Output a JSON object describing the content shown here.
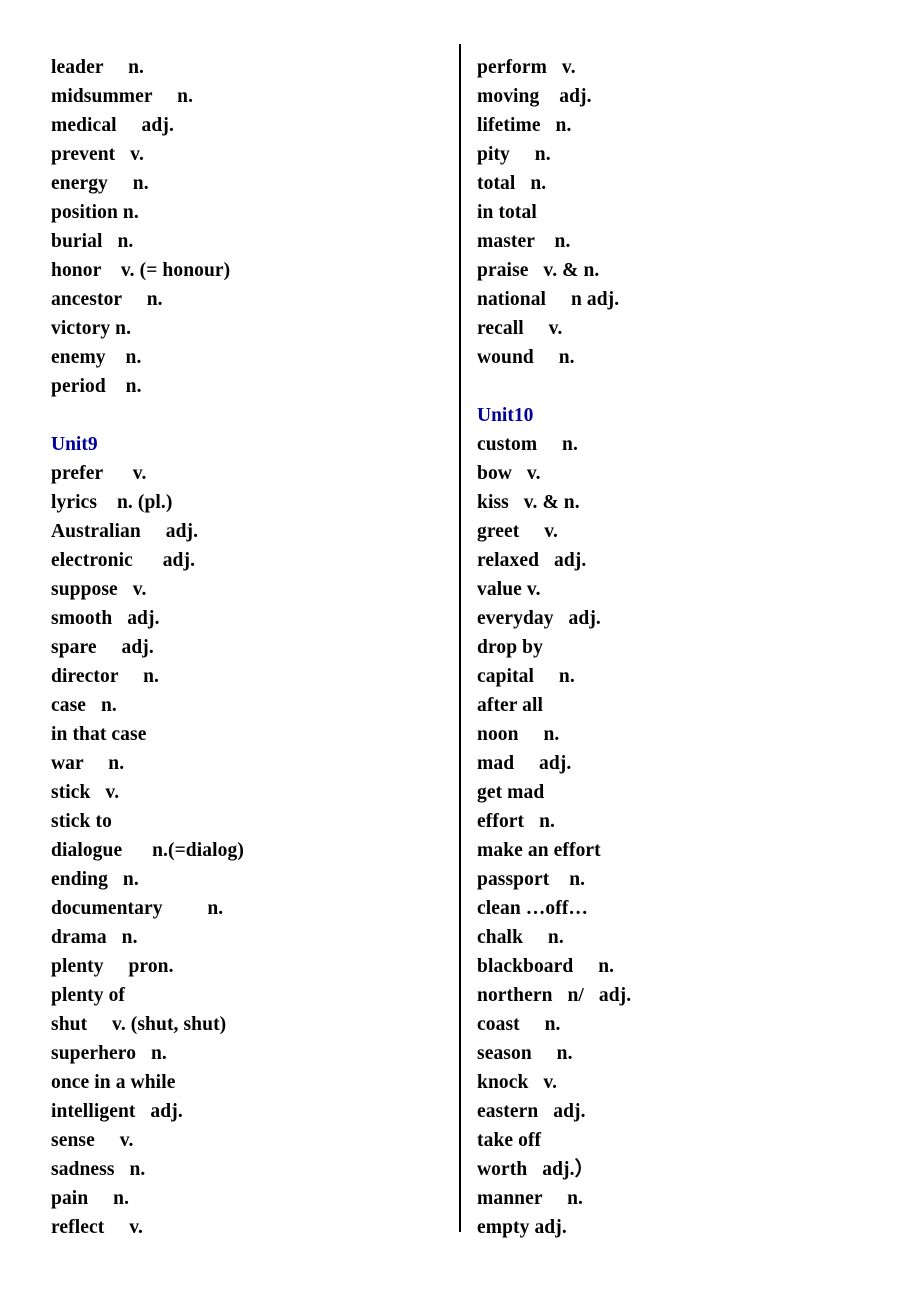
{
  "document": {
    "type": "vocabulary-word-list",
    "accent_color": "#00009B",
    "text_color": "#000000",
    "background_color": "#ffffff"
  },
  "left_column": {
    "blocks": [
      {
        "kind": "entries",
        "items": [
          "leader     n.",
          "midsummer     n.",
          "medical     adj.",
          "prevent   v.",
          "energy     n.",
          "position n.",
          "burial   n.",
          "honor    v. (= honour)",
          "ancestor     n.",
          "victory n.",
          "enemy    n.",
          "period    n."
        ]
      },
      {
        "kind": "spacer"
      },
      {
        "kind": "heading",
        "label": "Unit9"
      },
      {
        "kind": "entries",
        "items": [
          "prefer      v.",
          "lyrics    n. (pl.)",
          "Australian     adj.",
          "electronic      adj.",
          "suppose   v.",
          "smooth   adj.",
          "spare     adj.",
          "director     n.",
          "case   n.",
          "in that case",
          "war     n.",
          "stick   v.",
          "stick to",
          "dialogue      n.(=dialog)",
          "ending   n.",
          "documentary         n.",
          "drama   n.",
          "plenty     pron.",
          "plenty of",
          "shut     v. (shut, shut)",
          "superhero   n.",
          "once in a while",
          "intelligent   adj.",
          "sense     v.",
          "sadness   n.",
          "pain     n.",
          "reflect     v."
        ]
      }
    ]
  },
  "right_column": {
    "blocks": [
      {
        "kind": "entries",
        "items": [
          "perform   v.",
          "moving    adj.",
          "lifetime   n.",
          "pity     n.",
          "total   n.",
          "in total",
          "master    n.",
          "praise   v. & n.",
          "national     n adj.",
          "recall     v.",
          "wound     n."
        ]
      },
      {
        "kind": "spacer"
      },
      {
        "kind": "heading",
        "label": "Unit10"
      },
      {
        "kind": "entries",
        "items": [
          "custom     n.",
          "bow   v.",
          "kiss   v. & n.",
          "greet     v.",
          "relaxed   adj.",
          "value v.",
          "everyday   adj.",
          "drop by",
          "capital     n.",
          "after all",
          "noon     n.",
          "mad     adj.",
          "get mad",
          "effort   n.",
          "make an effort",
          "passport    n.",
          "clean …off…",
          "chalk     n.",
          "blackboard     n.",
          "northern   n/   adj.",
          "coast     n.",
          "season     n.",
          "knock   v.",
          "eastern   adj.",
          "take off",
          "worth   adj.）",
          "manner     n.",
          "empty adj."
        ]
      }
    ]
  }
}
